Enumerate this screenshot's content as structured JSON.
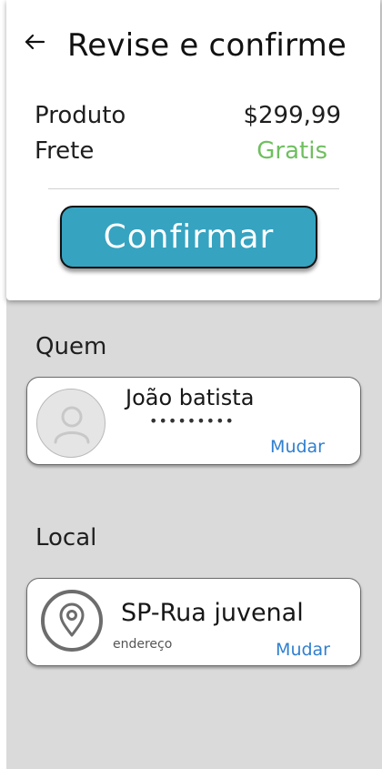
{
  "header": {
    "title": "Revise e confirme"
  },
  "summary": {
    "product_label": "Produto",
    "product_value": "$299,99",
    "shipping_label": "Frete",
    "shipping_value": "Gratis",
    "shipping_color": "#6fbf5f"
  },
  "actions": {
    "confirm_label": "Confirmar",
    "confirm_color": "#36a3c0"
  },
  "who": {
    "section_label": "Quem",
    "name": "João batista",
    "detail": "•••••••••",
    "change_label": "Mudar",
    "avatar_icon": "user-icon"
  },
  "place": {
    "section_label": "Local",
    "title": "SP-Rua juvenal",
    "subtitle": "endereço",
    "change_label": "Mudar",
    "pin_icon": "map-pin-icon"
  }
}
